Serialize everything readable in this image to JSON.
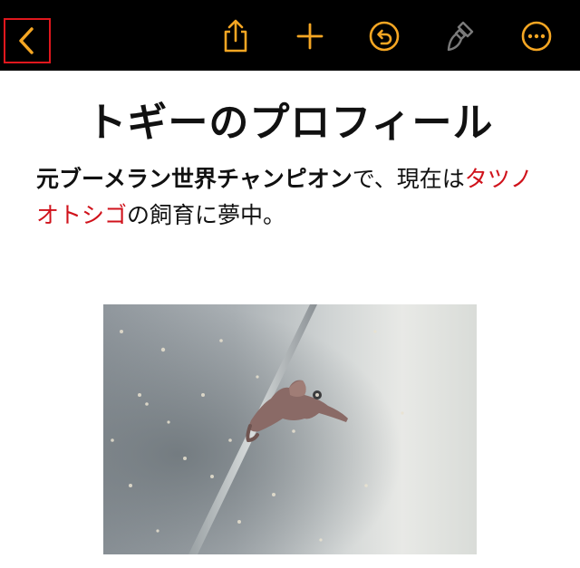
{
  "toolbar": {
    "accent": "#f5a623",
    "back_icon": "chevron-left-icon",
    "share_icon": "share-icon",
    "add_icon": "plus-icon",
    "undo_icon": "undo-icon",
    "format_icon": "paintbrush-icon",
    "more_icon": "ellipsis-icon"
  },
  "document": {
    "title": "トギーのプロフィール",
    "paragraph": {
      "bold_text": "元ブーメラン世界チャンピオン",
      "text_1": "で、現在は",
      "red_text": "タツノオトシゴ",
      "text_2": "の飼育に夢中。"
    },
    "highlight_color": "#d0121b"
  }
}
